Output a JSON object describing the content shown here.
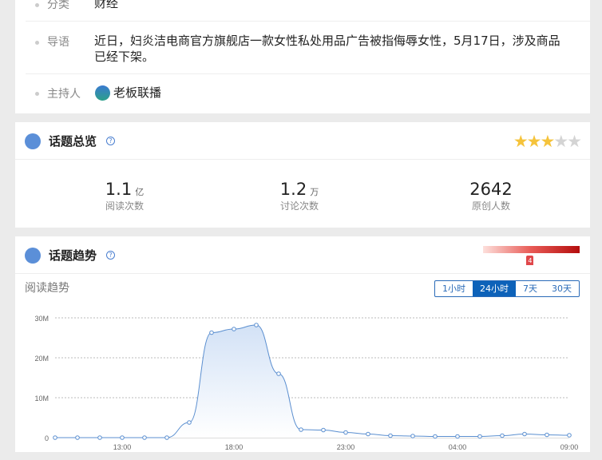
{
  "info": {
    "rows": [
      {
        "label": "分类",
        "value": "财经"
      },
      {
        "label": "导语",
        "value": "近日，妇炎洁电商官方旗舰店一款女性私处用品广告被指侮辱女性，5月17日，涉及商品已经下架。"
      },
      {
        "label": "主持人",
        "value": "老板联播"
      }
    ]
  },
  "overview": {
    "title": "话题总览",
    "help": "?",
    "rating": 3,
    "rating_max": 5,
    "stats": [
      {
        "value": "1.1",
        "unit": "亿",
        "label": "阅读次数"
      },
      {
        "value": "1.2",
        "unit": "万",
        "label": "讨论次数"
      },
      {
        "value": "2642",
        "unit": "",
        "label": "原创人数"
      }
    ]
  },
  "trend": {
    "title": "话题趋势",
    "help": "?",
    "heat_level": "4",
    "heat_level_fraction": 0.45,
    "subtitle": "阅读趋势",
    "tabs": [
      {
        "label": "1小时"
      },
      {
        "label": "24小时",
        "active": true
      },
      {
        "label": "7天"
      },
      {
        "label": "30天"
      }
    ]
  },
  "chart_data": {
    "type": "area",
    "ylabel": "",
    "xlabel": "",
    "ylim": [
      0,
      30
    ],
    "yticks": [
      "0",
      "10M",
      "20M",
      "30M"
    ],
    "xticks": [
      "13:00",
      "18:00",
      "23:00",
      "04:00",
      "09:00"
    ],
    "series": [
      {
        "name": "阅读趋势",
        "unit": "M",
        "values": [
          0,
          0,
          0,
          0,
          0,
          0,
          3.8,
          26.3,
          27.2,
          28.2,
          16,
          2,
          1.9,
          1.3,
          0.9,
          0.5,
          0.4,
          0.3,
          0.3,
          0.3,
          0.5,
          0.9,
          0.7,
          0.6
        ]
      }
    ],
    "colors": {
      "line": "#5b8fd0",
      "fill": "#dbe7f7"
    }
  }
}
